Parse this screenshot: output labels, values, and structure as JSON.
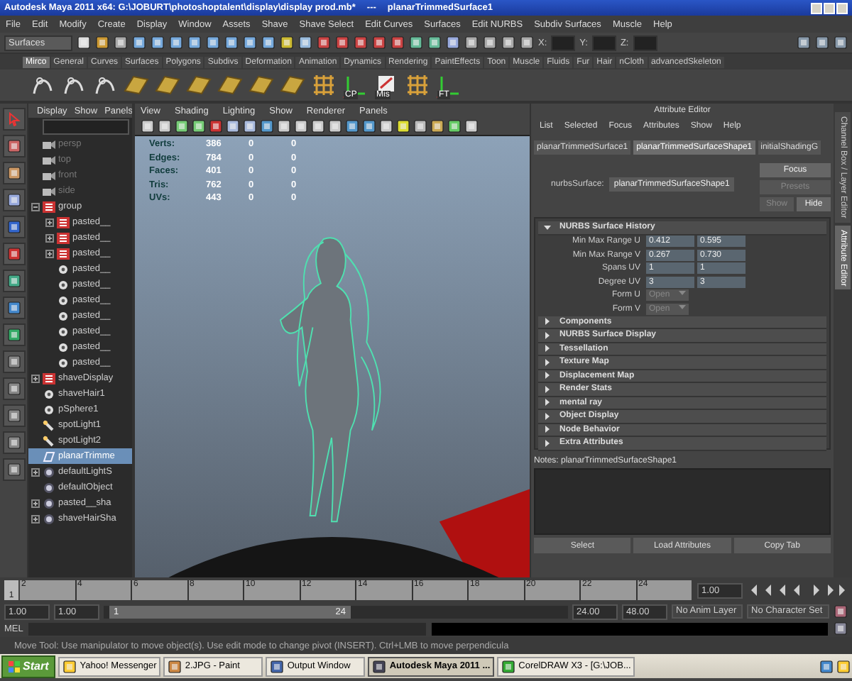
{
  "window": {
    "title": "Autodesk Maya 2011 x64: G:\\JOBURT\\photoshoptalent\\display\\display prod.mb*",
    "separator": "---",
    "object": "planarTrimmedSurface1"
  },
  "menus": [
    "File",
    "Edit",
    "Modify",
    "Create",
    "Display",
    "Window",
    "Assets",
    "Shave",
    "Shave Select",
    "Edit Curves",
    "Surfaces",
    "Edit NURBS",
    "Subdiv Surfaces",
    "Muscle",
    "Help"
  ],
  "status_line": {
    "menu_set": "Surfaces",
    "coords": [
      "X:",
      "Y:",
      "Z:"
    ]
  },
  "shelf_tabs": [
    {
      "label": "Mirco",
      "selected": true
    },
    {
      "label": "General",
      "selected": false
    },
    {
      "label": "Curves",
      "selected": false
    },
    {
      "label": "Surfaces",
      "selected": false
    },
    {
      "label": "Polygons",
      "selected": false
    },
    {
      "label": "Subdivs",
      "selected": false
    },
    {
      "label": "Deformation",
      "selected": false
    },
    {
      "label": "Animation",
      "selected": false
    },
    {
      "label": "Dynamics",
      "selected": false
    },
    {
      "label": "Rendering",
      "selected": false
    },
    {
      "label": "PaintEffects",
      "selected": false
    },
    {
      "label": "Toon",
      "selected": false
    },
    {
      "label": "Muscle",
      "selected": false
    },
    {
      "label": "Fluids",
      "selected": false
    },
    {
      "label": "Fur",
      "selected": false
    },
    {
      "label": "Hair",
      "selected": false
    },
    {
      "label": "nCloth",
      "selected": false
    },
    {
      "label": "advancedSkeleton",
      "selected": false
    }
  ],
  "shelf_items": [
    {
      "kind": "curve"
    },
    {
      "kind": "curve"
    },
    {
      "kind": "curve"
    },
    {
      "kind": "surface"
    },
    {
      "kind": "surface"
    },
    {
      "kind": "surface"
    },
    {
      "kind": "surface"
    },
    {
      "kind": "surface"
    },
    {
      "kind": "surface"
    },
    {
      "kind": "grid"
    },
    {
      "kind": "axis",
      "label": "CP"
    },
    {
      "kind": "note",
      "label": "Mis"
    },
    {
      "kind": "grid"
    },
    {
      "kind": "axis",
      "label": "FT"
    }
  ],
  "outliner": {
    "menus": [
      "Display",
      "Show",
      "Panels"
    ],
    "items": [
      {
        "name": "persp",
        "kind": "camera",
        "selected": false
      },
      {
        "name": "top",
        "kind": "camera",
        "selected": false
      },
      {
        "name": "front",
        "kind": "camera",
        "selected": false
      },
      {
        "name": "side",
        "kind": "camera",
        "selected": false
      },
      {
        "name": "group",
        "kind": "group",
        "selected": false,
        "expanded": true,
        "children": [
          {
            "name": "pasted__",
            "kind": "group",
            "selected": false,
            "expanded": false
          },
          {
            "name": "pasted__",
            "kind": "group",
            "selected": false,
            "expanded": false
          },
          {
            "name": "pasted__",
            "kind": "group",
            "selected": false,
            "expanded": false
          },
          {
            "name": "pasted__",
            "kind": "mesh",
            "selected": false
          },
          {
            "name": "pasted__",
            "kind": "mesh",
            "selected": false
          },
          {
            "name": "pasted__",
            "kind": "mesh",
            "selected": false
          },
          {
            "name": "pasted__",
            "kind": "mesh",
            "selected": false
          },
          {
            "name": "pasted__",
            "kind": "mesh",
            "selected": false
          },
          {
            "name": "pasted__",
            "kind": "mesh",
            "selected": false
          },
          {
            "name": "pasted__",
            "kind": "mesh",
            "selected": false
          }
        ]
      },
      {
        "name": "shaveDisplay",
        "kind": "group",
        "selected": false,
        "expanded": false
      },
      {
        "name": "shaveHair1",
        "kind": "mesh",
        "selected": false
      },
      {
        "name": "pSphere1",
        "kind": "mesh",
        "selected": false
      },
      {
        "name": "spotLight1",
        "kind": "light",
        "selected": false
      },
      {
        "name": "spotLight2",
        "kind": "light",
        "selected": false
      },
      {
        "name": "planarTrimme",
        "kind": "surface",
        "selected": true
      },
      {
        "name": "defaultLightS",
        "kind": "set",
        "selected": false,
        "expanded": false
      },
      {
        "name": "defaultObject",
        "kind": "set",
        "selected": false
      },
      {
        "name": "pasted__sha",
        "kind": "set",
        "selected": false,
        "expanded": false
      },
      {
        "name": "shaveHairSha",
        "kind": "set",
        "selected": false,
        "expanded": false
      }
    ]
  },
  "viewport": {
    "menus": [
      "View",
      "Shading",
      "Lighting",
      "Show",
      "Renderer",
      "Panels"
    ],
    "hud": [
      {
        "label": "Verts:",
        "values": [
          "386",
          "0",
          "0"
        ]
      },
      {
        "label": "Edges:",
        "values": [
          "784",
          "0",
          "0"
        ]
      },
      {
        "label": "Faces:",
        "values": [
          "401",
          "0",
          "0"
        ]
      },
      {
        "label": "Tris:",
        "values": [
          "762",
          "0",
          "0"
        ]
      },
      {
        "label": "UVs:",
        "values": [
          "443",
          "0",
          "0"
        ]
      }
    ]
  },
  "attribute_editor": {
    "title": "Attribute Editor",
    "menus": [
      "List",
      "Selected",
      "Focus",
      "Attributes",
      "Show",
      "Help"
    ],
    "tabs": [
      {
        "label": "planarTrimmedSurface1",
        "selected": false
      },
      {
        "label": "planarTrimmedSurfaceShape1",
        "selected": true
      },
      {
        "label": "initialShadingG",
        "selected": false
      }
    ],
    "node_label": "nurbsSurface:",
    "node_value": "planarTrimmedSurfaceShape1",
    "buttons": [
      {
        "label": "Focus",
        "disabled": false
      },
      {
        "label": "Presets",
        "disabled": true
      },
      {
        "label": "Show",
        "disabled": true
      },
      {
        "label": "Hide",
        "disabled": false
      }
    ],
    "sections": [
      {
        "title": "NURBS Surface History",
        "expanded": true,
        "rows": [
          {
            "kind": "pair",
            "label": "Min Max Range U",
            "values": [
              "0.412",
              "0.595"
            ]
          },
          {
            "kind": "pair",
            "label": "Min Max Range V",
            "values": [
              "0.267",
              "0.730"
            ]
          },
          {
            "kind": "pair",
            "label": "Spans UV",
            "values": [
              "1",
              "1"
            ]
          },
          {
            "kind": "pair",
            "label": "Degree UV",
            "values": [
              "3",
              "3"
            ]
          },
          {
            "kind": "dropdown",
            "label": "Form U",
            "value": "Open"
          },
          {
            "kind": "dropdown",
            "label": "Form V",
            "value": "Open"
          }
        ]
      },
      {
        "title": "Components",
        "expanded": false
      },
      {
        "title": "NURBS Surface Display",
        "expanded": false
      },
      {
        "title": "Tessellation",
        "expanded": false
      },
      {
        "title": "Texture Map",
        "expanded": false
      },
      {
        "title": "Displacement Map",
        "expanded": false
      },
      {
        "title": "Render Stats",
        "expanded": false
      },
      {
        "title": "mental ray",
        "expanded": false
      },
      {
        "title": "Object Display",
        "expanded": false
      },
      {
        "title": "Node Behavior",
        "expanded": false
      },
      {
        "title": "Extra Attributes",
        "expanded": false
      }
    ],
    "notes_label": "Notes:  planarTrimmedSurfaceShape1",
    "bottom_buttons": [
      "Select",
      "Load Attributes",
      "Copy Tab"
    ]
  },
  "side_tabs": [
    {
      "label": "Channel Box / Layer Editor",
      "selected": false
    },
    {
      "label": "Attribute Editor",
      "selected": true
    }
  ],
  "time_slider": {
    "current_frame": "1",
    "level": 0,
    "ticks": [
      "2",
      "4",
      "6",
      "8",
      "10",
      "12",
      "14",
      "16",
      "18",
      "20",
      "22",
      "24"
    ],
    "current_time": "1.00"
  },
  "range_slider": {
    "level": 0.5,
    "start": "1.00",
    "playback_start": "1.00",
    "range_start": "1",
    "range_end": "24",
    "playback_end": "24.00",
    "end": "48.00",
    "anim_layer": "No Anim Layer",
    "character_set": "No Character Set"
  },
  "command_line": {
    "label": "MEL"
  },
  "help_line": "Move Tool: Use manipulator to move object(s). Use edit mode to change pivot (INSERT).  Ctrl+LMB to move perpendicula",
  "taskbar": {
    "start": "Start",
    "tasks": [
      {
        "label": "Yahoo! Messenger",
        "selected": false
      },
      {
        "label": "2.JPG - Paint",
        "selected": false
      },
      {
        "label": "Output Window",
        "selected": false
      },
      {
        "label": "Autodesk Maya 2011 ...",
        "selected": true
      },
      {
        "label": "CorelDRAW X3 - [G:\\JOB...",
        "selected": false
      }
    ]
  }
}
